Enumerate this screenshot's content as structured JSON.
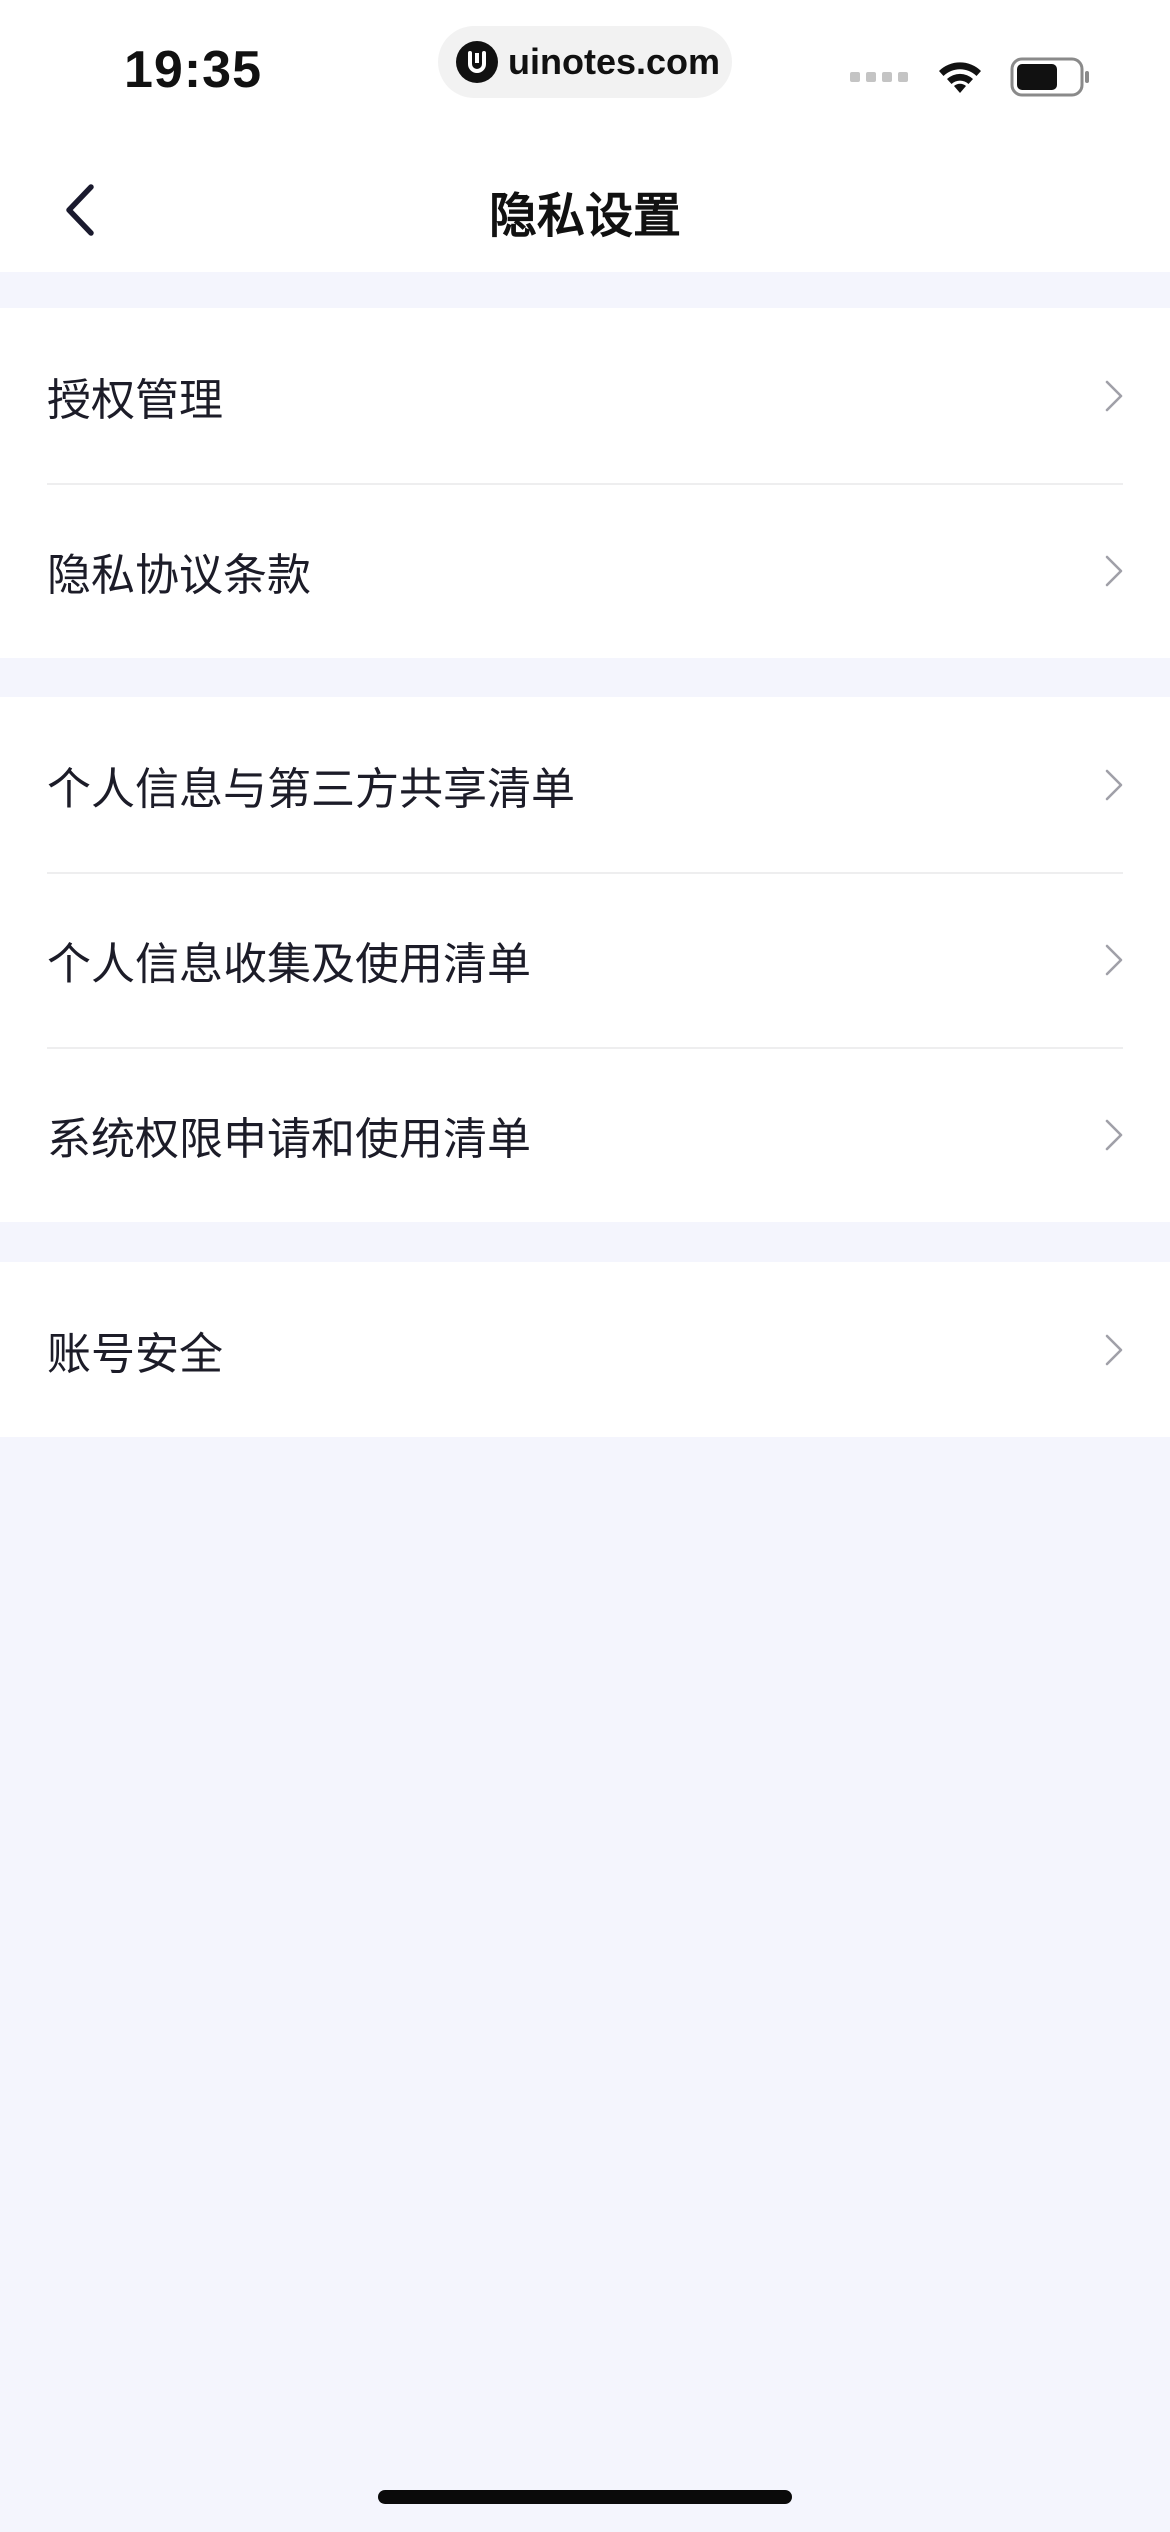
{
  "status_bar": {
    "time": "19:35",
    "url": "uinotes.com"
  },
  "nav": {
    "title": "隐私设置",
    "back_icon": "chevron-left-icon"
  },
  "groups": [
    {
      "items": [
        {
          "label": "授权管理"
        },
        {
          "label": "隐私协议条款"
        }
      ]
    },
    {
      "items": [
        {
          "label": "个人信息与第三方共享清单"
        },
        {
          "label": "个人信息收集及使用清单"
        },
        {
          "label": "系统权限申请和使用清单"
        }
      ]
    },
    {
      "items": [
        {
          "label": "账号安全"
        }
      ]
    }
  ],
  "colors": {
    "background": "#f4f5fd",
    "card": "#ffffff",
    "text": "#1c1c28",
    "chevron": "#a0a0a8"
  }
}
